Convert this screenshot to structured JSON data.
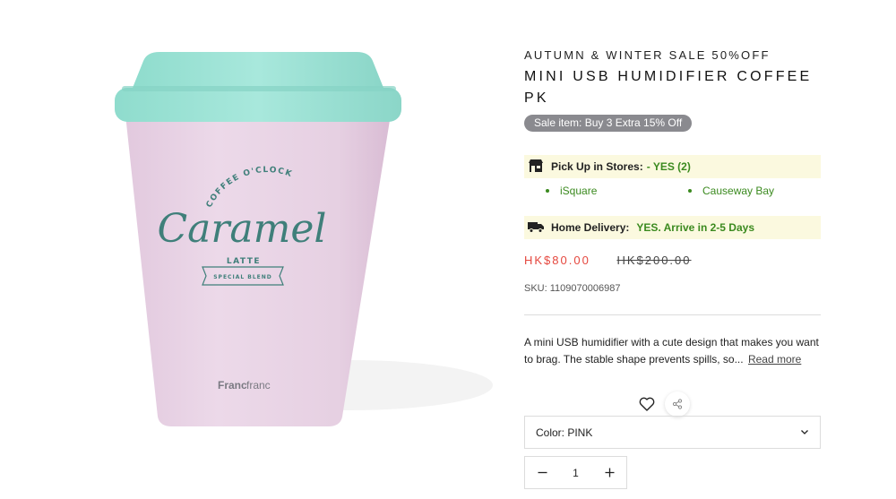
{
  "product": {
    "image_alt": "Pink coffee cup shaped mini USB humidifier with mint lid",
    "cup_print": {
      "arc_text": "COFFEE O'CLOCK",
      "script_text": "Caramel",
      "sub_text": "LATTE",
      "banner_text": "SPECIAL BLEND",
      "brand_bold": "Franc",
      "brand_light": "franc"
    },
    "sale_label": "AUTUMN & WINTER SALE 50%OFF",
    "title": "MINI USB HUMIDIFIER COFFEE PK",
    "sale_badge": "Sale item: Buy 3 Extra 15% Off"
  },
  "availability": {
    "pickup_label": "Pick Up in Stores:",
    "pickup_status": "- YES (2)",
    "stores": [
      "iSquare",
      "Causeway Bay"
    ],
    "delivery_label": "Home Delivery:",
    "delivery_status": "YES. Arrive in 2-5 Days"
  },
  "price": {
    "current": "HK$80.00",
    "original": "HK$200.00"
  },
  "sku": "SKU: 1109070006987",
  "description": {
    "text": "A mini USB humidifier with a cute design that makes you want to brag. The stable shape prevents spills, so...",
    "read_more": "Read more"
  },
  "options": {
    "color_label": "Color: PINK"
  },
  "quantity": {
    "value": "1"
  },
  "colors": {
    "accent_price": "#e5473e",
    "availability_green": "#3b8a1f",
    "highlight_bg": "#fbf9df",
    "badge_gray": "#8a8a8f",
    "cup_pink": "#e9d4e6",
    "lid_mint": "#9ee3d6",
    "print_teal": "#3f7f7a"
  },
  "icons": {
    "store": "storefront-icon",
    "truck": "delivery-truck-icon",
    "wishlist": "heart-icon",
    "share": "share-icon",
    "select": "chevron-down-icon",
    "decrease": "minus-icon",
    "increase": "plus-icon"
  }
}
